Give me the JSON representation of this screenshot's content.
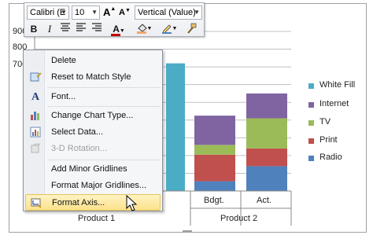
{
  "toolbar": {
    "font_name": "Calibri (E",
    "font_size": "10",
    "grow_font_label": "A",
    "shrink_font_label": "A",
    "element_select": "Vertical (Value)",
    "bold": "B",
    "italic": "I",
    "font_color_label": "A"
  },
  "context_menu": {
    "items": [
      {
        "label": "Delete",
        "enabled": true,
        "icon": "none"
      },
      {
        "label": "Reset to Match Style",
        "enabled": true,
        "icon": "reset-style-icon"
      },
      {
        "label": "Font...",
        "enabled": true,
        "icon": "font-icon",
        "icon_text": "A"
      },
      {
        "label": "Change Chart Type...",
        "enabled": true,
        "icon": "chart-type-icon"
      },
      {
        "label": "Select Data...",
        "enabled": true,
        "icon": "select-data-icon"
      },
      {
        "label": "3-D Rotation...",
        "enabled": false,
        "icon": "rotation-icon"
      },
      {
        "label": "Add Minor Gridlines",
        "enabled": true,
        "icon": "none"
      },
      {
        "label": "Format Major Gridlines...",
        "enabled": true,
        "icon": "none"
      },
      {
        "label": "Format Axis...",
        "enabled": true,
        "icon": "format-axis-icon",
        "highlighted": true
      }
    ]
  },
  "chart_data": {
    "type": "bar",
    "stacked": true,
    "y_tick_labels": [
      "900",
      "800",
      "700"
    ],
    "ylim": [
      0,
      900
    ],
    "categories_inner": [
      "Bdgt.",
      "Act."
    ],
    "categories_outer": [
      "Product 1",
      "Product 2"
    ],
    "series": [
      {
        "name": "White Fill",
        "color": "#4bacc6"
      },
      {
        "name": "Internet",
        "color": "#8064a2"
      },
      {
        "name": "TV",
        "color": "#9bbb59"
      },
      {
        "name": "Print",
        "color": "#c0504d"
      },
      {
        "name": "Radio",
        "color": "#4f81bd"
      }
    ],
    "bars": [
      {
        "category": "Product 1",
        "series": "White Fill",
        "value": 720
      },
      {
        "category": "Bdgt.",
        "values": {
          "Radio": 55,
          "Print": 150,
          "TV": 55,
          "Internet": 165
        }
      },
      {
        "category": "Act.",
        "values": {
          "Radio": 140,
          "Print": 100,
          "TV": 170,
          "Internet": 140
        }
      }
    ],
    "legend_position": "right",
    "grid": true
  },
  "colors": {
    "menu_highlight": "#fde28a",
    "gridline": "#c0c0c0"
  }
}
